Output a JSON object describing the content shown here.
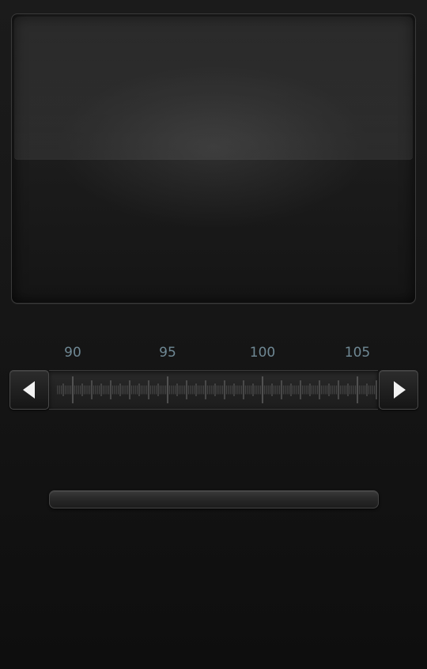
{
  "tuner": {
    "scale_labels": [
      "90",
      "95",
      "100",
      "105"
    ],
    "scale_start": 89.2,
    "scale_end": 106.5,
    "tune_down_icon": "triangle-left-icon",
    "tune_up_icon": "triangle-right-icon"
  },
  "colors": {
    "label": "#6f8894",
    "tick": "#8a8a8a",
    "background": "#141414"
  }
}
